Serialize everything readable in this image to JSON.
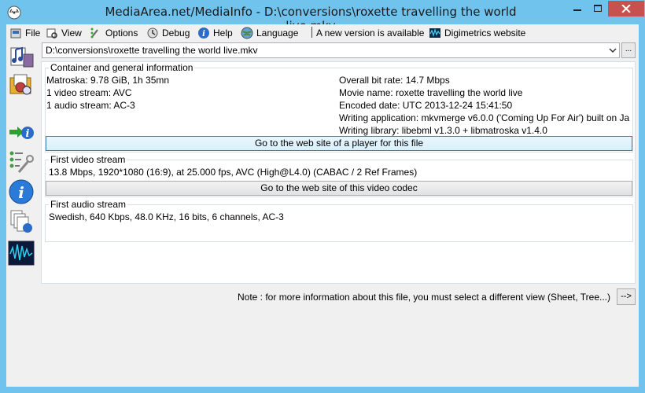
{
  "window": {
    "title": "MediaArea.net/MediaInfo - D:\\conversions\\roxette travelling the world live.mkv"
  },
  "menu": {
    "file": "File",
    "view": "View",
    "options": "Options",
    "debug": "Debug",
    "help": "Help",
    "language": "Language",
    "new_version": "A new version is available",
    "digimetrics": "Digimetrics website"
  },
  "file_path": "D:\\conversions\\roxette travelling the world live.mkv",
  "browse_label": "...",
  "general": {
    "title": "Container and general information",
    "left": [
      "Matroska: 9.78 GiB, 1h 35mn",
      "1 video stream: AVC",
      "1 audio stream: AC-3"
    ],
    "right": [
      "Overall bit rate: 14.7 Mbps",
      "Movie name: roxette travelling the world live",
      "Encoded date: UTC 2013-12-24 15:41:50",
      "Writing application: mkvmerge v6.0.0 ('Coming Up For Air') built on Ja",
      "Writing library: libebml v1.3.0 + libmatroska v1.4.0"
    ],
    "button": "Go to the web site of a player for this file"
  },
  "video": {
    "title": "First video stream",
    "info": "13.8 Mbps, 1920*1080 (16:9), at 25.000 fps, AVC (High@L4.0) (CABAC / 2 Ref Frames)",
    "button": "Go to the web site of this video codec"
  },
  "audio": {
    "title": "First audio stream",
    "info": "Swedish, 640 Kbps, 48.0 KHz, 16 bits, 6 channels, AC-3"
  },
  "note": {
    "text": "Note : for more information about this file, you must select a different view (Sheet, Tree...)",
    "button": "-->"
  },
  "colors": {
    "frame": "#6fc3ec",
    "close": "#c75050",
    "client": "#f0f0f0"
  }
}
